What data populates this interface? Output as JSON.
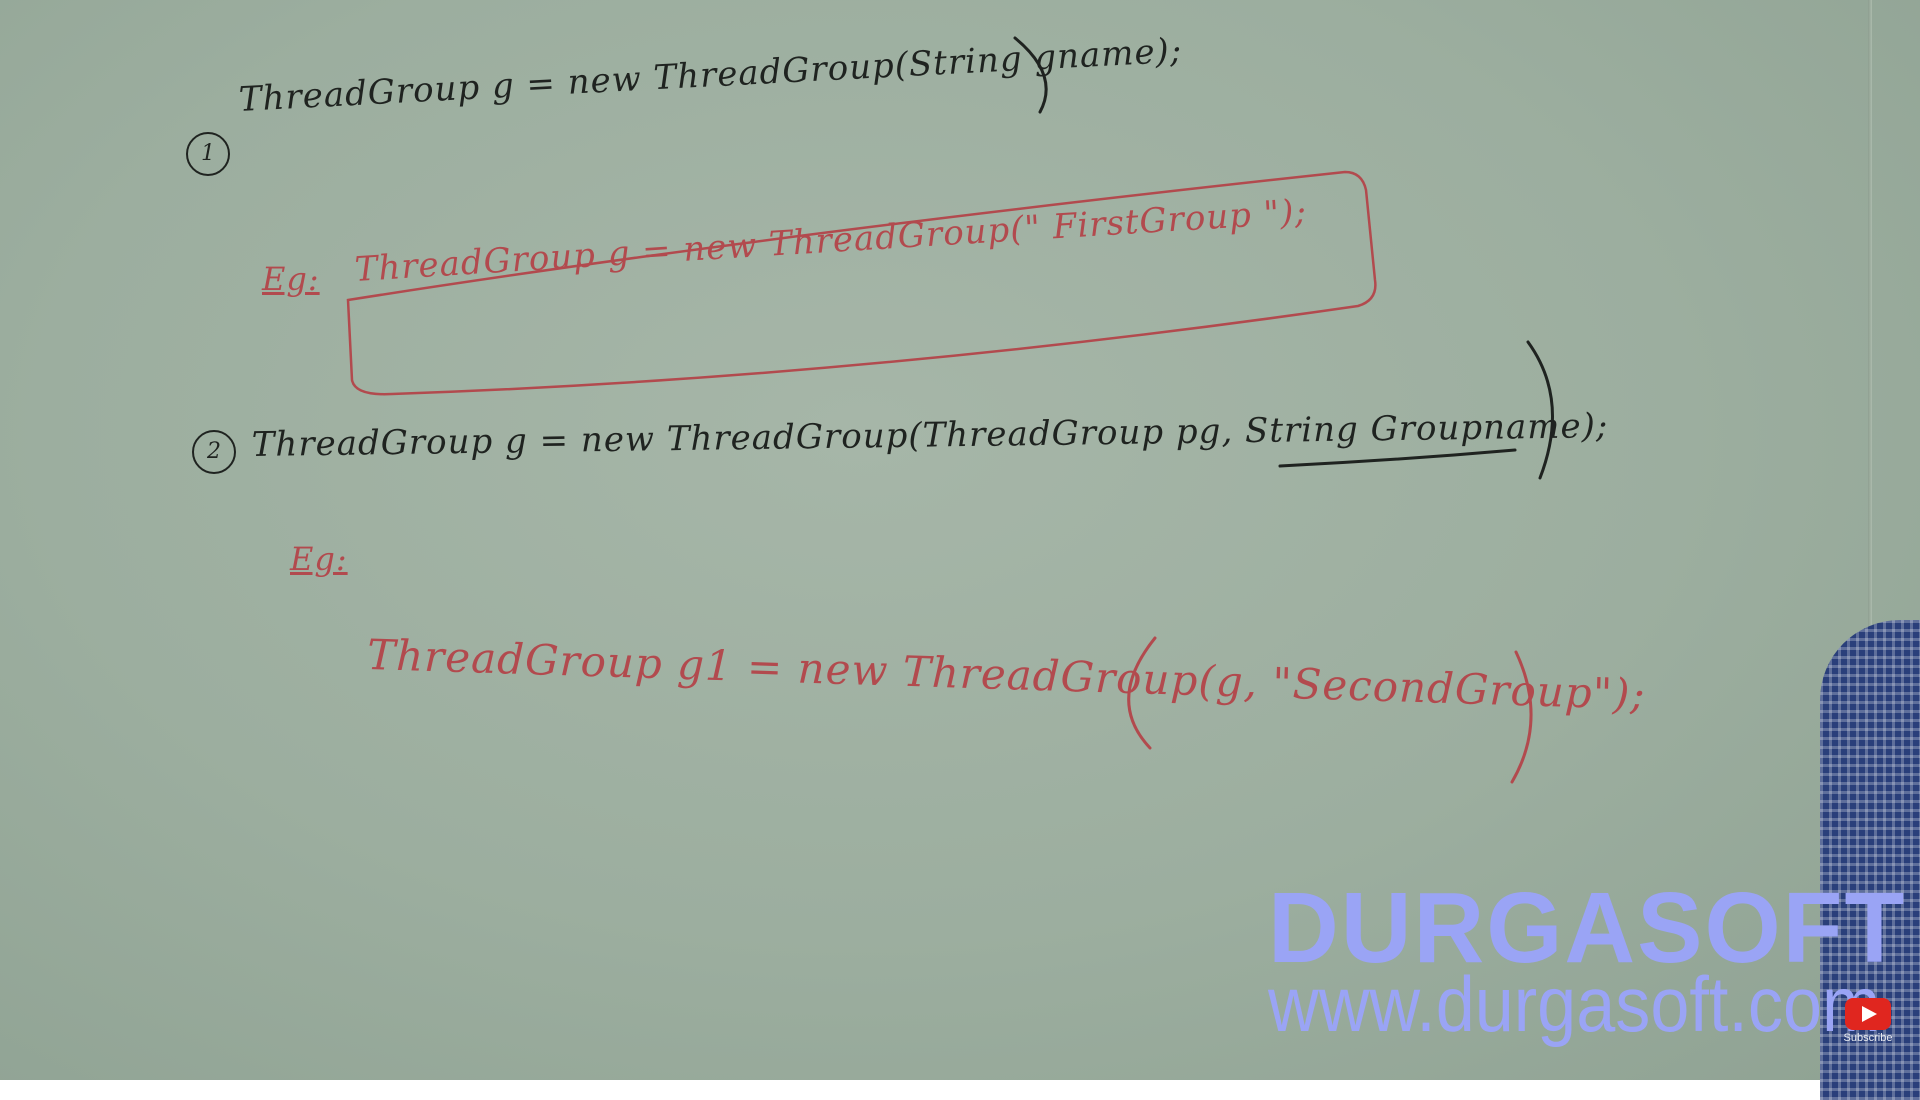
{
  "board": {
    "line1": {
      "number": "1",
      "text": "ThreadGroup   g = new   ThreadGroup(String gname);"
    },
    "eg1": {
      "label": "Eg:",
      "text": "ThreadGroup   g = new   ThreadGroup(\" FirstGroup \");"
    },
    "line2": {
      "number": "2",
      "text": "ThreadGroup   g = new   ThreadGroup(ThreadGroup  pg, String Groupname);"
    },
    "eg2": {
      "label": "Eg:",
      "text": "ThreadGroup  g1 = new  ThreadGroup(g, \"SecondGroup\");"
    }
  },
  "watermark": {
    "title": "DURGASOFT",
    "url": "www.durgasoft.com"
  },
  "subscribe": {
    "label": "Subscribe",
    "icon": "youtube-play-icon"
  },
  "colors": {
    "board": "#9fb0a2",
    "black_marker": "#1f2320",
    "red_marker": "#b24a4e",
    "watermark": "#9aa4f5",
    "subscribe": "#e0261f"
  }
}
